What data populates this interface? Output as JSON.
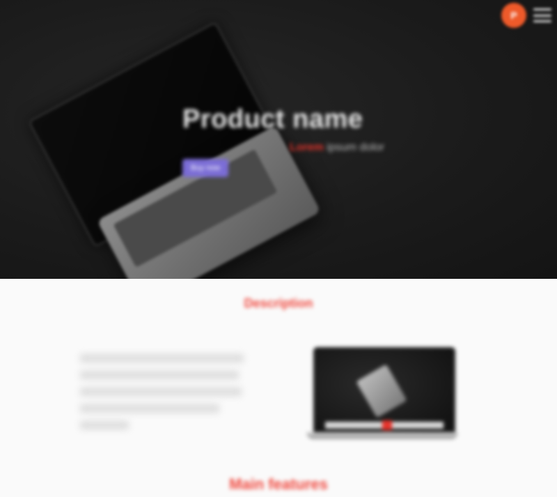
{
  "nav": {
    "logo_text": "P",
    "menu_icon": "hamburger-icon"
  },
  "hero": {
    "title": "Product name",
    "subtitle_accent": "Lorem",
    "subtitle_rest": " ipsum dolor",
    "cta_label": "Buy now"
  },
  "sections": {
    "section1_heading": "Description",
    "section2_heading": "Main features"
  },
  "colors": {
    "hero_bg": "#1b1b1b",
    "accent_red": "#f0463c",
    "cta_purple": "#7b6dd6",
    "logo_orange": "#ee5a2a"
  }
}
